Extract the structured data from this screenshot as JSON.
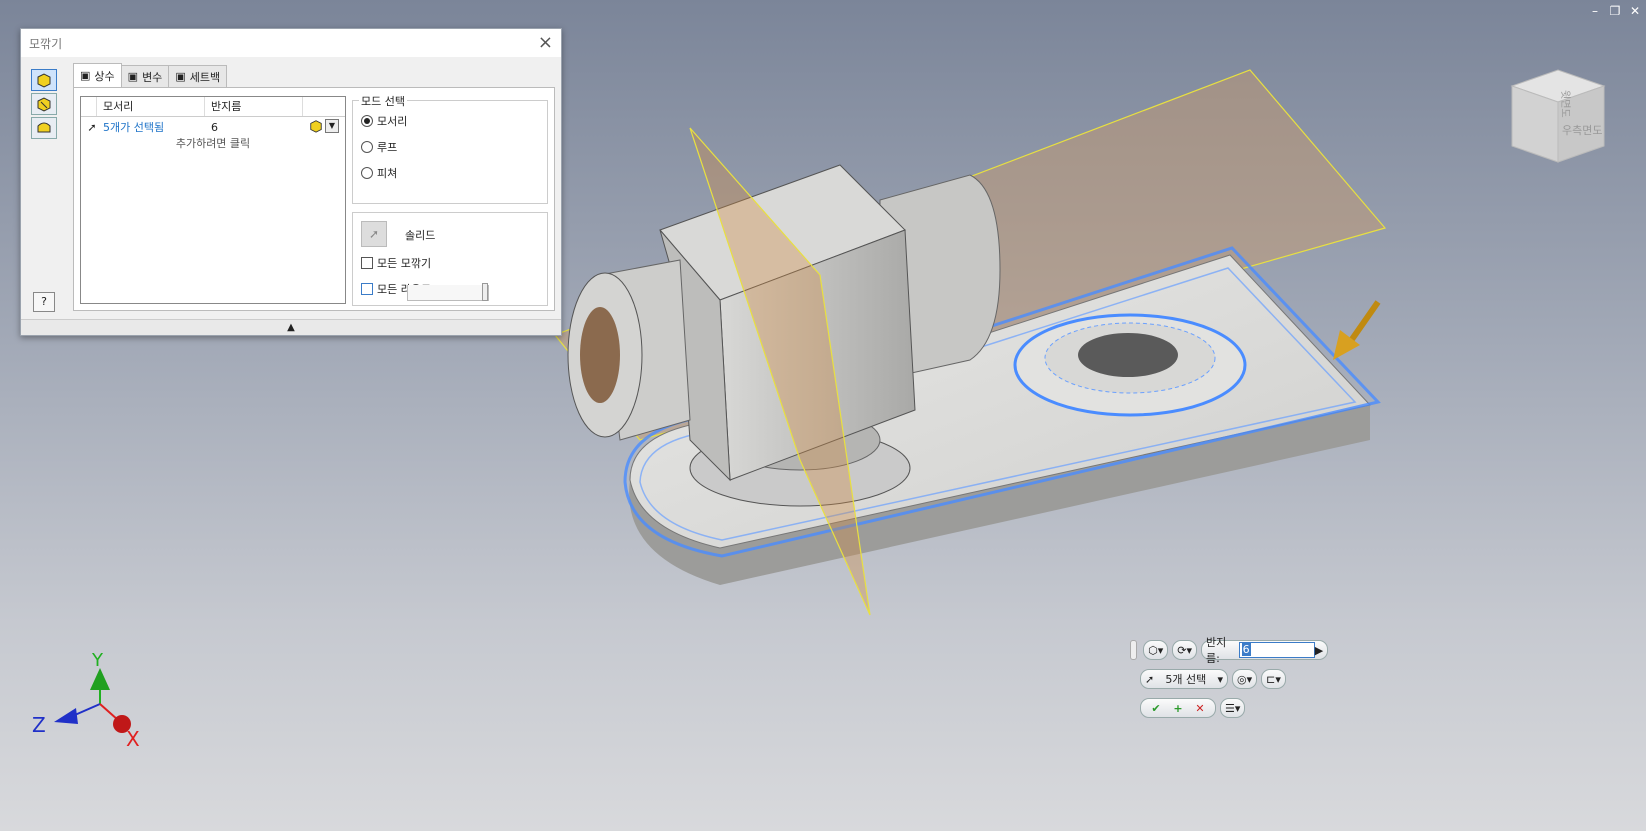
{
  "dialog": {
    "title": "모깎기",
    "tabs": [
      {
        "label": "상수"
      },
      {
        "label": "변수"
      },
      {
        "label": "세트백"
      }
    ],
    "table": {
      "col_edge": "모서리",
      "col_radius": "반지름",
      "row_edge": "5개가 선택됨",
      "row_radius": "6",
      "add_hint": "추가하려면 클릭"
    },
    "mode": {
      "label": "모드 선택",
      "options": [
        "모서리",
        "루프",
        "피쳐"
      ],
      "selected": "모서리"
    },
    "solid_label": "솔리드",
    "all_fillets": "모든 모깎기",
    "all_rounds": "모든 라운드",
    "help": "?",
    "expand_arrow": "▲"
  },
  "viewcube": {
    "face_right": "우측면도",
    "face_top": "윗면도"
  },
  "minitoolbar": {
    "radius_label": "반지름:",
    "radius_value": "6",
    "selection": "5개 선택"
  },
  "triad": {
    "x": "X",
    "y": "Y",
    "z": "Z"
  },
  "colors": {
    "accent": "#1e73c8",
    "plane": "#c89a6a",
    "highlight": "#4a8cff",
    "axis_x": "#e02020",
    "axis_y": "#20b020",
    "axis_z": "#2030c8"
  }
}
